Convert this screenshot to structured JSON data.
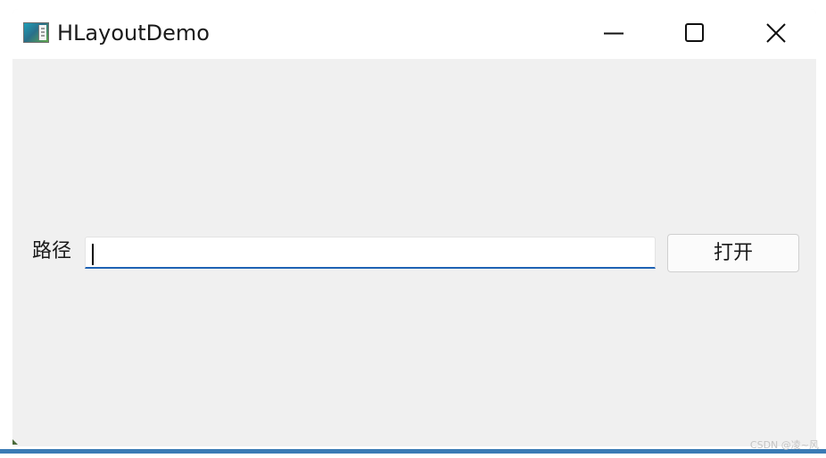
{
  "window": {
    "title": "HLayoutDemo",
    "icon": "app-icon"
  },
  "titlebar_buttons": {
    "minimize_icon": "minimize-icon",
    "maximize_icon": "maximize-icon",
    "close_icon": "close-icon"
  },
  "form": {
    "path_label": "路径",
    "path_value": "",
    "open_button_label": "打开"
  },
  "colors": {
    "content_background": "#f0f0f0",
    "input_focus_underline": "#1f63b4",
    "bottom_bar": "#3a7bb5"
  },
  "watermark": "CSDN @凌~风"
}
